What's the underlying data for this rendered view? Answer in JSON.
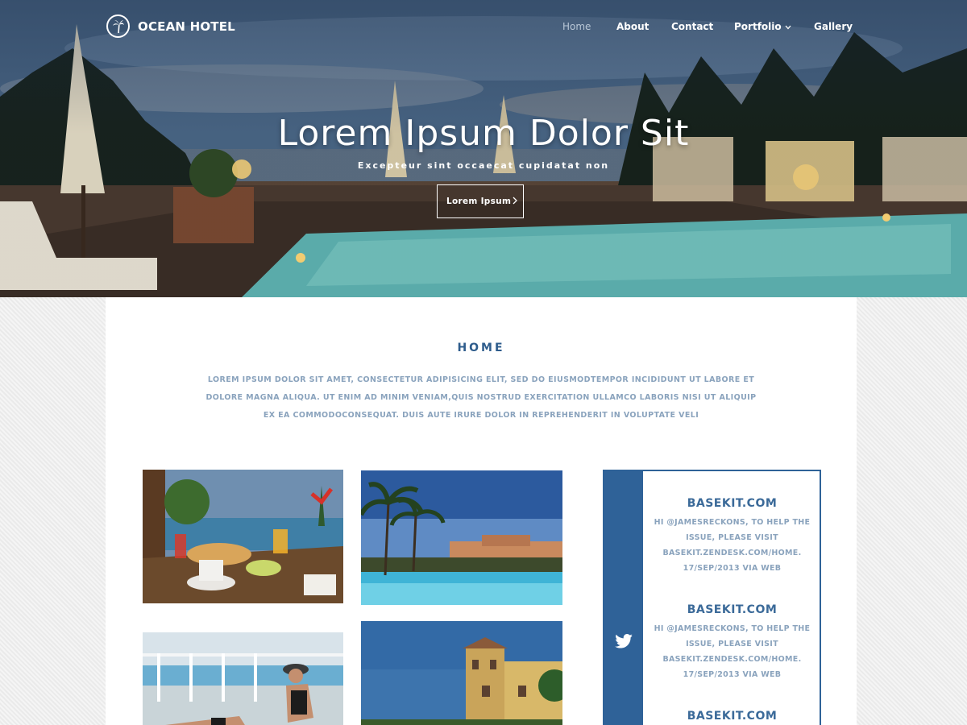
{
  "brand": {
    "name": "OCEAN HOTEL",
    "logo_icon": "palm-tree-icon"
  },
  "nav": {
    "items": [
      {
        "label": "Home",
        "active": true
      },
      {
        "label": "About"
      },
      {
        "label": "Contact"
      },
      {
        "label": "Portfolio",
        "has_dropdown": true
      },
      {
        "label": "Gallery"
      }
    ]
  },
  "hero": {
    "title": "Lorem Ipsum Dolor Sit",
    "subtitle": "Excepteur sint occaecat cupidatat non",
    "button_label": "Lorem Ipsum"
  },
  "section": {
    "title": "HOME",
    "text": "LOREM IPSUM DOLOR SIT AMET, CONSECTETUR ADIPISICING ELIT, SED DO EIUSMODTEMPOR INCIDIDUNT UT LABORE ET DOLORE MAGNA ALIQUA. UT ENIM AD MINIM VENIAM,QUIS NOSTRUD EXERCITATION ULLAMCO LABORIS NISI UT ALIQUIP EX EA COMMODOCONSEQUAT. DUIS AUTE IRURE DOLOR IN REPREHENDERIT IN VOLUPTATE VELI"
  },
  "tweets": [
    {
      "title": "BASEKIT.COM",
      "body": "HI @JAMESRECKONS, TO HELP THE ISSUE, PLEASE VISIT BASEKIT.ZENDESK.COM/HOME. 17/SEP/2013 VIA WEB"
    },
    {
      "title": "BASEKIT.COM",
      "body": "HI @JAMESRECKONS, TO HELP THE ISSUE, PLEASE VISIT BASEKIT.ZENDESK.COM/HOME. 17/SEP/2013 VIA WEB"
    },
    {
      "title": "BASEKIT.COM",
      "body": ""
    }
  ],
  "colors": {
    "accent": "#2f6298",
    "heading": "#2e5c8c",
    "muted_text": "#8aa3bd"
  }
}
